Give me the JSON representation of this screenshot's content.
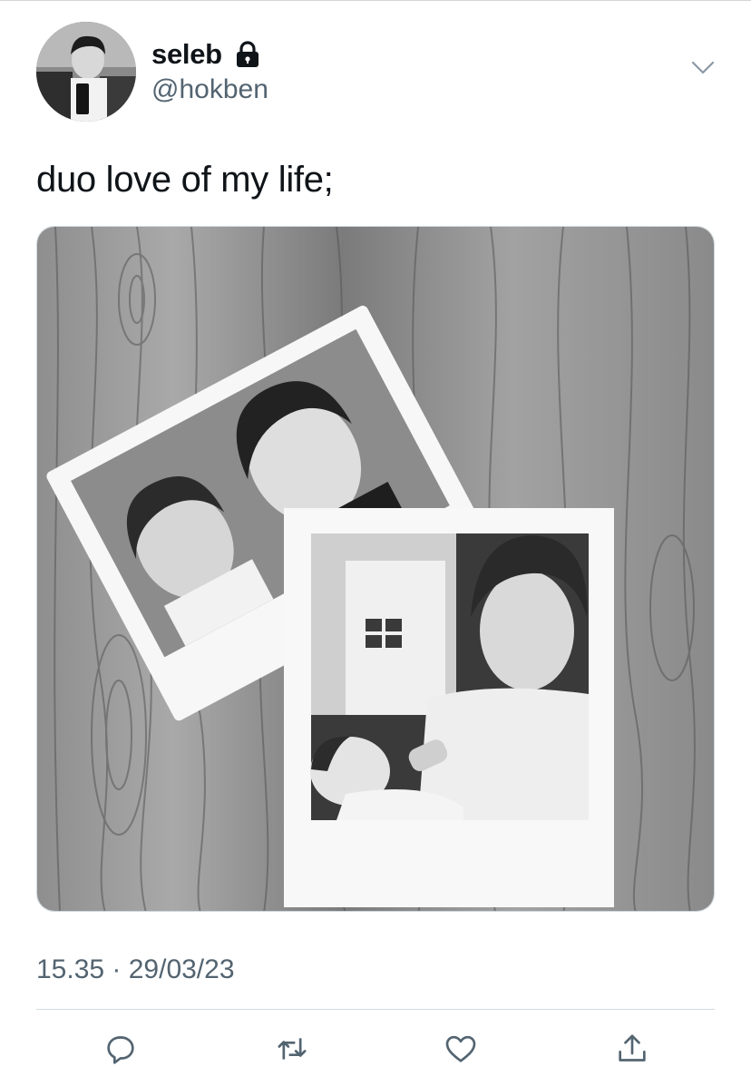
{
  "author": {
    "display_name": "seleb",
    "handle": "@hokben",
    "protected": true
  },
  "tweet": {
    "text": "duo love of my life;",
    "timestamp": "15.35 · 29/03/23"
  },
  "icons": {
    "lock": "lock-icon",
    "menu": "chevron-down-icon",
    "actions": [
      "reply-icon",
      "retweet-icon",
      "like-icon",
      "share-icon"
    ]
  },
  "colors": {
    "text_primary": "#0f1419",
    "text_secondary": "#536471",
    "divider": "#cfd9de",
    "icon": "#536471"
  }
}
